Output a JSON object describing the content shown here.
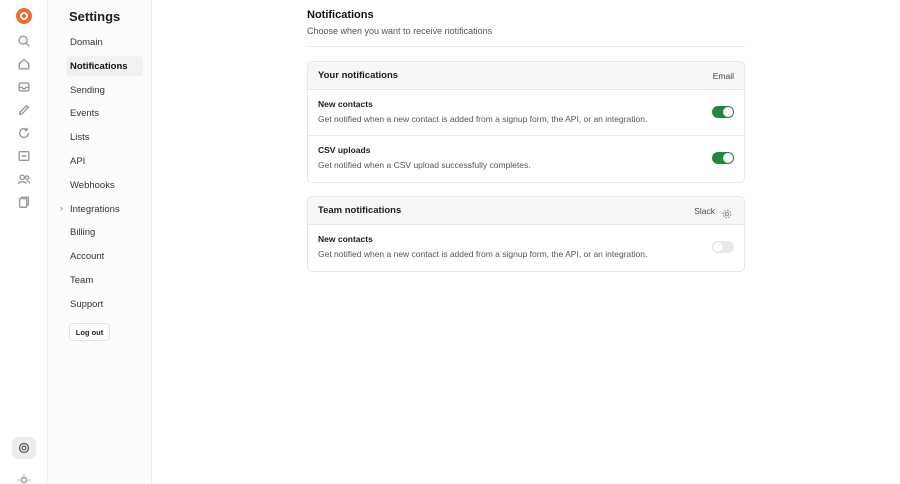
{
  "sidebar": {
    "title": "Settings",
    "items": [
      {
        "label": "Domain"
      },
      {
        "label": "Notifications",
        "active": true
      },
      {
        "label": "Sending"
      },
      {
        "label": "Events"
      },
      {
        "label": "Lists"
      },
      {
        "label": "API"
      },
      {
        "label": "Webhooks"
      },
      {
        "label": "Integrations",
        "has_chevron": true
      },
      {
        "label": "Billing"
      },
      {
        "label": "Account"
      },
      {
        "label": "Team"
      },
      {
        "label": "Support"
      }
    ],
    "logout_label": "Log out"
  },
  "rail": {
    "icons": [
      "search-icon",
      "home-icon",
      "inbox-icon",
      "edit-icon",
      "refresh-icon",
      "template-icon",
      "contacts-icon",
      "files-icon"
    ],
    "bottom_icons": [
      "help-icon",
      "theme-icon"
    ]
  },
  "main": {
    "title": "Notifications",
    "subtitle": "Choose when you want to receive notifications"
  },
  "your_notifications": {
    "title": "Your notifications",
    "channel": "Email",
    "rows": [
      {
        "title": "New contacts",
        "description": "Get notified when a new contact is added from a signup form, the API, or an integration.",
        "enabled": true
      },
      {
        "title": "CSV uploads",
        "description": "Get notified when a CSV upload successfully completes.",
        "enabled": true
      }
    ]
  },
  "team_notifications": {
    "title": "Team notifications",
    "channel": "Slack",
    "channel_icon": "gear-icon",
    "rows": [
      {
        "title": "New contacts",
        "description": "Get notified when a new contact is added from a signup form, the API, or an integration.",
        "enabled": false
      }
    ]
  },
  "colors": {
    "accent": "#1f8a3d",
    "brand": "#f26a2e"
  }
}
